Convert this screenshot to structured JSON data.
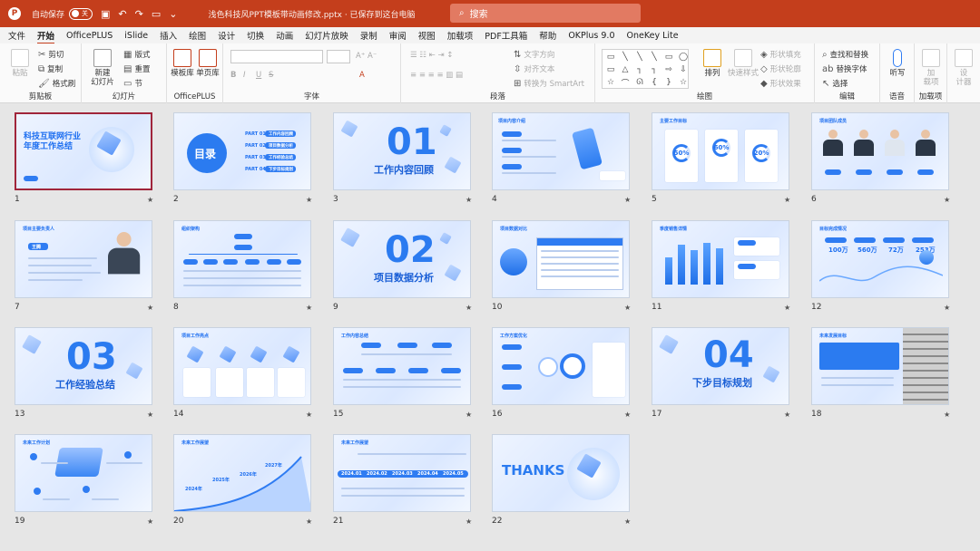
{
  "titlebar": {
    "logo": "P",
    "autosave_label": "自动保存",
    "autosave_state": "关",
    "filename": "浅色科技风PPT模板带动画修改.pptx · 已保存到这台电脑",
    "search_placeholder": "搜索"
  },
  "menu_tabs": [
    "文件",
    "开始",
    "OfficePLUS",
    "iSlide",
    "插入",
    "绘图",
    "设计",
    "切换",
    "动画",
    "幻灯片放映",
    "录制",
    "审阅",
    "视图",
    "加载项",
    "PDF工具箱",
    "帮助",
    "OKPlus 9.0",
    "OneKey Lite"
  ],
  "ribbon": {
    "clipboard": {
      "paste": "粘贴",
      "cut": "剪切",
      "copy": "复制",
      "format_painter": "格式刷",
      "label": "剪贴板"
    },
    "slides": {
      "new_slide": "新建\n幻灯片",
      "layout": "版式",
      "reset": "重置",
      "section": "节",
      "label": "幻灯片"
    },
    "officeplus": {
      "template_lib": "模板库",
      "single_page": "单页库",
      "label": "OfficePLUS"
    },
    "font": {
      "bold": "B",
      "italic": "I",
      "underline": "U",
      "strike": "S",
      "label": "字体"
    },
    "paragraph": {
      "text_direction": "文字方向",
      "align_text": "对齐文本",
      "smartart": "转换为 SmartArt",
      "label": "段落"
    },
    "drawing": {
      "arrange": "排列",
      "quick_styles": "快速样式",
      "shape_fill": "形状填充",
      "shape_outline": "形状轮廓",
      "shape_effects": "形状效果",
      "label": "绘图"
    },
    "editing": {
      "find_replace": "查找和替换",
      "replace_font": "替换字体",
      "select": "选择",
      "label": "编辑"
    },
    "voice": {
      "dictate": "听写",
      "label": "语音"
    },
    "addins": {
      "addins": "加\n载项",
      "label": "加载项"
    },
    "designer": {
      "designer": "设\n计器"
    }
  },
  "slides": [
    {
      "num": "1",
      "title": "科技互联网行业\n年度工作总结"
    },
    {
      "num": "2",
      "title": "目录",
      "parts": [
        "PART 01",
        "PART 02",
        "PART 03",
        "PART 04"
      ],
      "items": [
        "工作内容回顾",
        "项目数据分析",
        "工作经验总结",
        "下步目标规划"
      ]
    },
    {
      "num": "3",
      "number": "01",
      "subtitle": "工作内容回顾"
    },
    {
      "num": "4",
      "title": "项目内容介绍"
    },
    {
      "num": "5",
      "title": "主要工作目标",
      "rings": [
        "50%",
        "60%",
        "20%"
      ]
    },
    {
      "num": "6",
      "title": "项目团队成员"
    },
    {
      "num": "7",
      "title": "项目主要负责人",
      "name": "王腾"
    },
    {
      "num": "8",
      "title": "组织架构"
    },
    {
      "num": "9",
      "number": "02",
      "subtitle": "项目数据分析"
    },
    {
      "num": "10",
      "title": "项目数据对比"
    },
    {
      "num": "11",
      "title": "季度销售详情"
    },
    {
      "num": "12",
      "title": "目标完成情况",
      "stats": [
        "100万",
        "560万",
        "72万",
        "253万"
      ]
    },
    {
      "num": "13",
      "number": "03",
      "subtitle": "工作经验总结"
    },
    {
      "num": "14",
      "title": "项目工作亮点"
    },
    {
      "num": "15",
      "title": "工作内容总结"
    },
    {
      "num": "16",
      "title": "工作方案优化"
    },
    {
      "num": "17",
      "number": "04",
      "subtitle": "下步目标规划"
    },
    {
      "num": "18",
      "title": "未来发展目标"
    },
    {
      "num": "19",
      "title": "未来工作计划"
    },
    {
      "num": "20",
      "title": "未来工作展望",
      "years": [
        "2024年",
        "2025年",
        "2026年",
        "2027年"
      ]
    },
    {
      "num": "21",
      "title": "未来工作展望",
      "years": [
        "2024.01",
        "2024.02",
        "2024.03",
        "2024.04",
        "2024.05"
      ]
    },
    {
      "num": "22",
      "title": "THANKS"
    }
  ],
  "colors": {
    "accent": "#c43e1c",
    "slide_blue": "#2b7bf0",
    "selected_border": "#a0253a"
  }
}
